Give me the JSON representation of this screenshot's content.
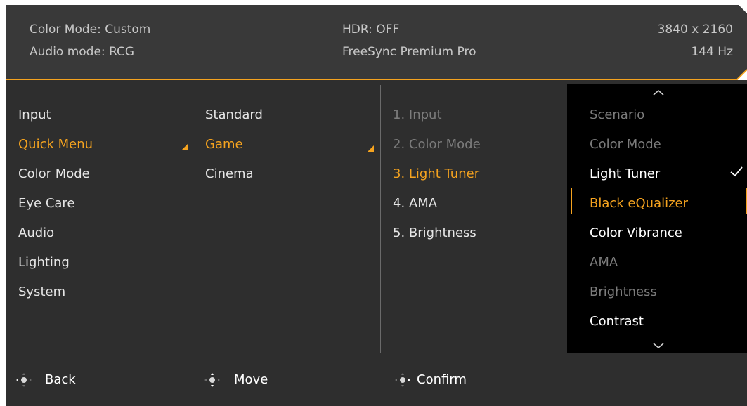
{
  "header": {
    "color_mode": "Color Mode: Custom",
    "audio_mode": "Audio mode: RCG",
    "hdr": "HDR: OFF",
    "freesync": "FreeSync Premium Pro",
    "resolution": "3840 x 2160",
    "refresh_rate": "144 Hz"
  },
  "main_menu": {
    "items": [
      "Input",
      "Quick Menu",
      "Color Mode",
      "Eye Care",
      "Audio",
      "Lighting",
      "System"
    ],
    "selected": "Quick Menu"
  },
  "quick_menu_modes": {
    "items": [
      "Standard",
      "Game",
      "Cinema"
    ],
    "selected": "Game"
  },
  "quick_menu_slots": {
    "items": [
      "1. Input",
      "2. Color Mode",
      "3. Light Tuner",
      "4. AMA",
      "5. Brightness"
    ],
    "selected": "3. Light Tuner"
  },
  "slot_options": {
    "items": [
      "Scenario",
      "Color Mode",
      "Light Tuner",
      "Black eQualizer",
      "Color Vibrance",
      "AMA",
      "Brightness",
      "Contrast"
    ],
    "checked": "Light Tuner",
    "highlighted": "Black eQualizer"
  },
  "footer": {
    "back": "Back",
    "move": "Move",
    "confirm": "Confirm"
  },
  "icons": {
    "scroll_up": "chevron-up-icon",
    "scroll_down": "chevron-down-icon",
    "check": "check-icon",
    "joystick": "joystick-icon"
  },
  "colors": {
    "accent": "#f5a31f",
    "panel": "#2e2e2e",
    "options_bg": "#000000",
    "dim_text": "#7c7c7c"
  }
}
